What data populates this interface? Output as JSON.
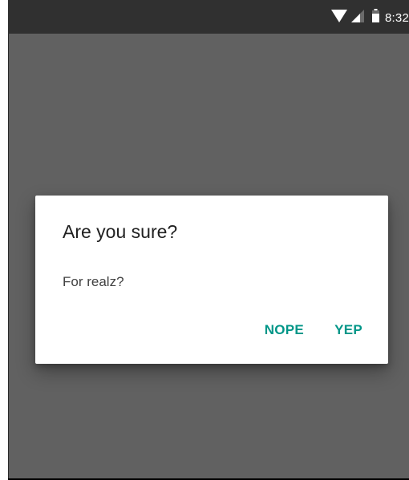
{
  "status_bar": {
    "time": "8:32",
    "icons": [
      "wifi-icon",
      "cell-signal-icon",
      "battery-icon"
    ]
  },
  "dialog": {
    "title": "Are you sure?",
    "message": "For realz?",
    "buttons": {
      "negative_label": "NOPE",
      "positive_label": "YEP"
    }
  },
  "colors": {
    "scrim": "#616161",
    "status_bar": "#303030",
    "accent": "#009688",
    "dialog_background": "#ffffff",
    "title_text": "#212121",
    "message_text": "#424242"
  }
}
